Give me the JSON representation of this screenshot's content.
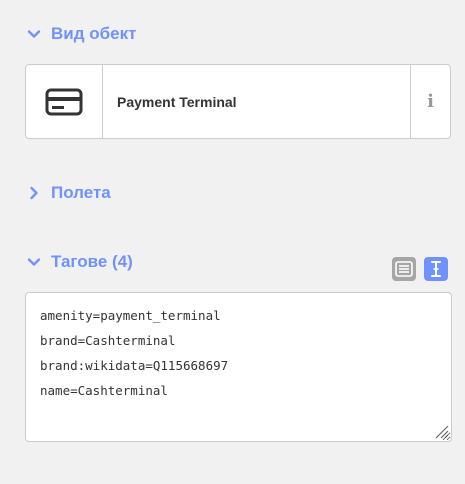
{
  "preset_section": {
    "title": "Вид обект",
    "expanded": true,
    "preset": {
      "name": "Payment Terminal",
      "icon": "credit-card-icon",
      "info_glyph": "i"
    }
  },
  "fields_section": {
    "title": "Полета",
    "expanded": false
  },
  "tags_section": {
    "title": "Тагове (4)",
    "expanded": true,
    "view_mode": "text",
    "tags": [
      "amenity=payment_terminal",
      "brand=Cashterminal",
      "brand:wikidata=Q115668697",
      "name=Cashterminal"
    ]
  },
  "colors": {
    "accent": "#7092ff",
    "background": "#f1f1f1",
    "inactive_button": "#a6a6a6"
  }
}
